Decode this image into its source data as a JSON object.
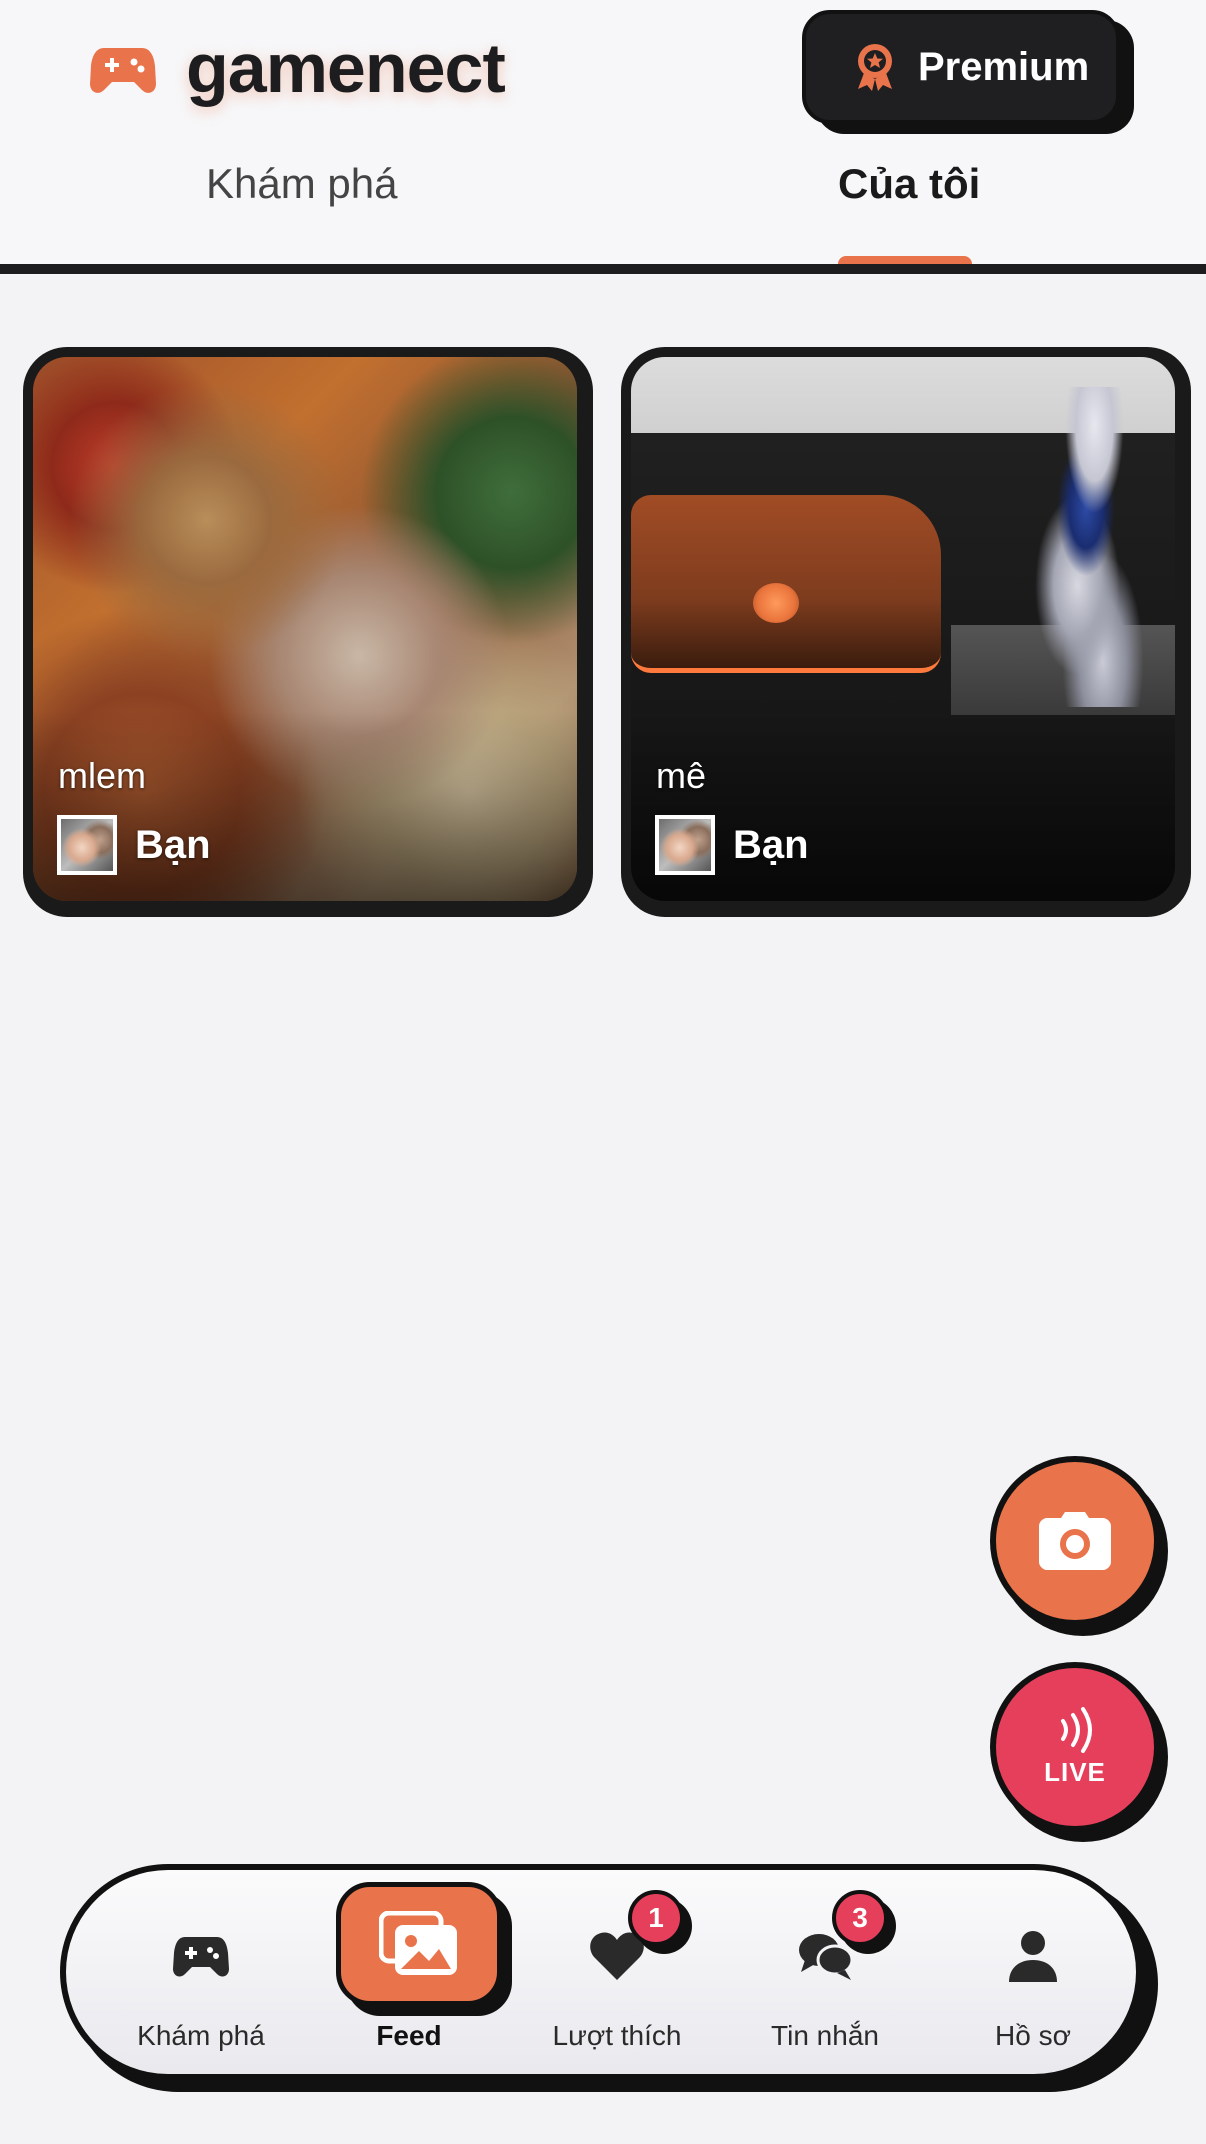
{
  "header": {
    "app_name": "gamenect",
    "premium_label": "Premium",
    "logo_icon": "gamepad-icon",
    "premium_icon": "award-badge-icon"
  },
  "tabs": [
    {
      "label": "Khám phá",
      "active": false
    },
    {
      "label": "Của tôi",
      "active": true
    }
  ],
  "posts": [
    {
      "caption": "mlem",
      "author": "Bạn"
    },
    {
      "caption": "mê",
      "author": "Bạn"
    }
  ],
  "floating": {
    "camera_icon": "camera-icon",
    "live_label": "LIVE",
    "live_icon": "broadcast-waves-icon"
  },
  "nav": {
    "items": [
      {
        "label": "Khám phá",
        "icon": "gamepad-icon",
        "active": false
      },
      {
        "label": "Feed",
        "icon": "images-icon",
        "active": true
      },
      {
        "label": "Lượt thích",
        "icon": "heart-icon",
        "badge": "1",
        "active": false
      },
      {
        "label": "Tin nhắn",
        "icon": "chat-bubbles-icon",
        "badge": "3",
        "active": false
      },
      {
        "label": "Hồ sơ",
        "icon": "person-icon",
        "active": false
      }
    ]
  },
  "colors": {
    "accent": "#e9734a",
    "live": "#e63f5b",
    "dark": "#1d1d1f",
    "background": "#f3f3f6"
  }
}
